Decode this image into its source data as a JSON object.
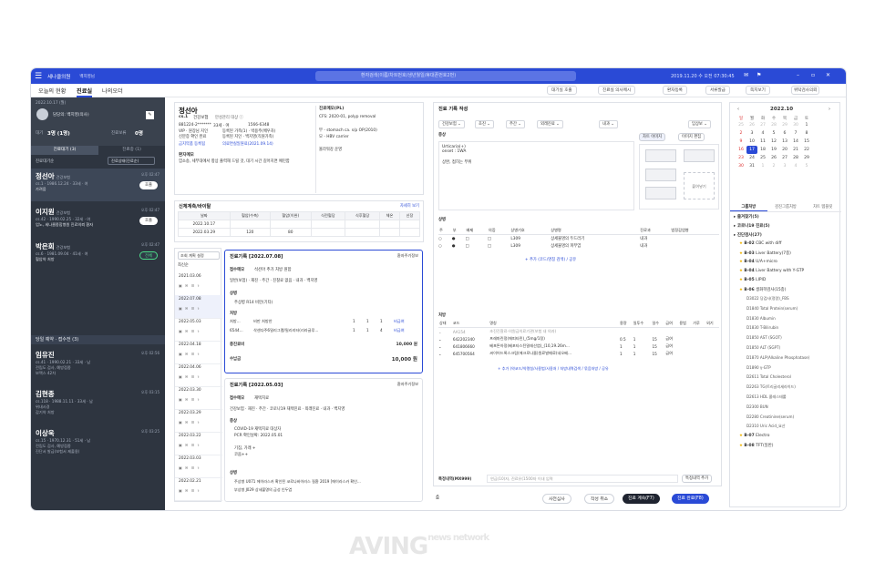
{
  "app": {
    "brand": "세나클의원",
    "user": "백지영님",
    "search_placeholder": "환자검색(이름/차트번호/생년월일/휴대폰번호2번)",
    "clock": "2019.11.20 수 오전 07:30:45"
  },
  "nav": {
    "tabs": [
      "오늘의 현황",
      "진료실",
      "나의오더"
    ],
    "buttons": [
      "대기실 호출",
      "진료실 의사메시",
      "환자등록",
      "서류발급",
      "쪽지보기",
      "위탁검사의뢰"
    ]
  },
  "left": {
    "date": "2022.10.17 (월)",
    "doctor": "담당의: 백지영(의사)",
    "counts": {
      "waiting_label": "대기",
      "waiting": "3명 (1명)",
      "done_label": "진료보류",
      "done": "0명"
    },
    "tabs": [
      "진료대기 (3)",
      "진료중 (1)"
    ],
    "filter": "진료대기순",
    "filter2": "진료상태(진료순)",
    "patients": [
      {
        "name": "정선아",
        "ins": "건강보험",
        "info": "cs.1 · 1986.12.24 · 33세 · 여",
        "note": "가려움",
        "time": "오후 02:47",
        "btn": "호출"
      },
      {
        "name": "이지원",
        "ins": "건강보험",
        "info": "cs.42 · 1990.02.25 · 32세 · 여",
        "note": "업노, 세나클종합병원 진료의뢰 환자",
        "time": "오후 02:47",
        "btn": "호출"
      },
      {
        "name": "박은희",
        "ins": "건강보험",
        "info": "cs.6 · 1981.09.04 · 41세 · 여",
        "note": "혈압약 처방",
        "time": "오후 02:47",
        "btn": "전체"
      }
    ],
    "section2": "당일 예약 · 접수전 (3)",
    "reservations": [
      {
        "name": "임유진",
        "ins": "건강보험",
        "info": "cs.41 · 1990.02.21 · 33세 · 남",
        "note": "전립도 검사, 예방접종",
        "note2": "보맥스 42차",
        "time": "오후 02:56"
      },
      {
        "name": "김현종",
        "ins": "건강보험",
        "info": "cs.118 · 1988.11.11 · 33세 · 남",
        "note": "위내시경",
        "note2": "감기약 처방",
        "time": "오후 03:15"
      },
      {
        "name": "이상욱",
        "ins": "건강보험",
        "info": "cs.15 · 1970.12.31 · 51세 · 남",
        "note": "전립도 검사, 예방접종",
        "note2": "진단서 발급(보험서 제출용)",
        "time": "오후 03:25"
      }
    ]
  },
  "patient": {
    "name": "정선아",
    "chart": "cs.1",
    "ins": "건강보험",
    "tag": "만성관리 대상 ⓘ",
    "rrn": "881224-2*******",
    "age": "33세 · 여",
    "phone": "1566-6348",
    "vip": "VIP · 원장님 지인",
    "reg1": "등록된 가족(1) · 박용주(배우자)",
    "reg2": "신분증 확인 완료",
    "reg3": "등록된 지인 · 백지영(직원가족)",
    "links": [
      "금지약품 등록됨",
      "의료면실일원료(2021.09.14)"
    ],
    "memo_label": "환자메모",
    "memo": "염소송, 세부대에서 항상 출력해 드릴 것, 대기 시간 길어지면 예민함",
    "history_label": "진료메모(PL)",
    "history": [
      "CFS: 2020-01, polyp removal",
      "부 - stomach ca. s/p OP(2010)",
      "모 - HBV carrier",
      "올라워강 운영"
    ]
  },
  "vitals": {
    "title": "신체계측/바이탈",
    "more": "자세히 보기",
    "headers": [
      "날짜",
      "혈압(수축)",
      "혈압(이완)",
      "식전혈당",
      "식후혈당",
      "체온",
      "신장"
    ],
    "rows": [
      [
        "2022.10.17",
        "",
        "",
        "",
        "",
        "",
        ""
      ],
      [
        "2022.03.29",
        "120",
        "80",
        "",
        "",
        "",
        ""
      ]
    ]
  },
  "history_list": {
    "filter": "조회 계획 설정",
    "sort": "최신순",
    "dates": [
      "2021.03.06",
      "2022.07.08",
      "2022.05.03",
      "2022.04.18",
      "2022.04.06",
      "2022.03.30",
      "2022.03.29",
      "2022.03.22",
      "2022.03.03",
      "2022.02.21"
    ]
  },
  "records": [
    {
      "title": "진료기록 [2022.07.08]",
      "copy": "환자주기정보",
      "memo_label": "접수메모",
      "memo": "석션아 추가 처방 원함",
      "types": "일반(보험) · 재진 · 주간 · 진찰료 없음 · 내과 · 백지영",
      "cond": "상병",
      "cond_rows": [
        "주상병 R14 비만(기타)"
      ],
      "rx": "처방",
      "rx_rows": [
        [
          "처방...",
          "비만 처방안",
          "1",
          "1",
          "1",
          "비급여"
        ],
        [
          "6544...",
          "삭센다주6밀리그램/밀리리터(리라글루...",
          "1",
          "1",
          "4",
          "비급여"
        ]
      ],
      "total_label": "총진료비",
      "total": "10,000 원",
      "recv_label": "수납금",
      "recv": "10,000 원"
    },
    {
      "title": "진료기록 [2022.05.03]",
      "copy": "환자주기정보",
      "memo_label": "접수메모",
      "memo": "재택치료",
      "types": "건강보험 · 재진 · 주간 · 코로나19 재택진료 · 외래진료 · 내과 · 백지영",
      "sym": "증상",
      "sym_rows": [
        "COVID-19 재택치료 대상자",
        "PCR 확인날짜: 2022.05.01",
        "기침, 가래 +",
        "코움++"
      ],
      "cond": "상병",
      "cond_rows": [
        "주상병 U071 에이라스카 확인된 코로나바이러스 질환 2019 [에이라스카 확인...",
        "부상병 J029 상세불명의 급성 인두염"
      ]
    }
  ],
  "write": {
    "title": "진료 기록 작성",
    "selects": [
      "건강보험",
      "초진",
      "주간",
      "외래진료",
      "내과",
      "임상보"
    ],
    "symptom_label": "증상",
    "symptom": [
      "Urticaria(+)",
      "onset : 1WA",
      "상완, 접히는 부위"
    ],
    "images": [
      "차트 이미지",
      "이미지 편집"
    ],
    "img_label": "붙여넣기",
    "cond_label": "상병",
    "cond_headers": [
      "주",
      "부",
      "배제",
      "의증",
      "상병기호",
      "상병명",
      "진료과",
      "법정감염병"
    ],
    "cond_rows": [
      [
        "L309",
        "상세불명의 두드러기",
        "내과"
      ],
      [
        "L309",
        "상세불명의 피부염",
        "내과"
      ]
    ],
    "cond_add": "+ 추가 (코드/명칭 검색) / 공유",
    "rx_label": "처방",
    "rx_headers": [
      "상태",
      "코드",
      "명칭",
      "용량",
      "일투수",
      "일수",
      "급여",
      "용법",
      "가루",
      "외기"
    ],
    "rx_rows": [
      [
        "AA154",
        "초진진찰료-의원급의료기관(보험 내 의과)",
        "",
        "",
        "",
        ""
      ],
      [
        "642202340",
        "프레마린정(에피타민)_(5mg/1정)",
        "0.5",
        "1",
        "15",
        "급여"
      ],
      [
        "641806660",
        "베포튼아정(베포타스틴말레산염)_(10,19.26m...",
        "1",
        "1",
        "15",
        "급여"
      ],
      [
        "645700564",
        "씨이어드록스크림(에크로나졸)원료발매료(네오베...",
        "1",
        "1",
        "15",
        "급여"
      ]
    ],
    "rx_add": "+ 추가 (약코드/약명칭/사용법/사용처 / 처방내역검색 / 묶음처방 / 공유",
    "special_label": "특정내역(MX999)",
    "special_placeholder": "연금(10)자, 진료유(1500자 이내 입력",
    "special_btn": "특정내역 추가"
  },
  "footer": {
    "left_btn": "처방전",
    "btns": [
      "사전심사",
      "작성 취소",
      "진료 계속(F7)",
      "진료 완료(F8)"
    ]
  },
  "right": {
    "month": "2022.10",
    "weekdays": [
      "일",
      "월",
      "화",
      "수",
      "목",
      "금",
      "토"
    ],
    "weeks": [
      [
        "25",
        "26",
        "27",
        "28",
        "29",
        "30",
        "1"
      ],
      [
        "2",
        "3",
        "4",
        "5",
        "6",
        "7",
        "8"
      ],
      [
        "9",
        "10",
        "11",
        "12",
        "13",
        "14",
        "15"
      ],
      [
        "16",
        "17",
        "18",
        "19",
        "20",
        "21",
        "22"
      ],
      [
        "23",
        "24",
        "25",
        "26",
        "27",
        "28",
        "29"
      ],
      [
        "30",
        "31",
        "1",
        "2",
        "3",
        "4",
        "5"
      ]
    ],
    "today": "17",
    "tabs": [
      "그룹처방",
      "검진그룹처방",
      "차트 템플릿"
    ],
    "groups": [
      "즐겨찾기(5)",
      "코로나19 진료(5)",
      "진단검사(27)"
    ],
    "items": [
      {
        "code": "B-02",
        "label": "CBC with diff"
      },
      {
        "code": "B-03",
        "label": "Liver Battery(7종)"
      },
      {
        "code": "B-04",
        "label": "U/A+micro"
      },
      {
        "code": "B-04",
        "label": "Liver Battery with Y-GTP"
      },
      {
        "code": "B-05",
        "label": "LIPID"
      },
      {
        "code": "B-06",
        "label": "생화학검사(15종)"
      }
    ],
    "subitems": [
      "D3022 당검사(정량)_FBS",
      "D1840 Total Protein(serum)",
      "D1830 Albumin",
      "D1830 T-Bilirubin",
      "D1850 AST (SGOT)",
      "D1850 ALT (SGPT)",
      "D1870 ALP(Alkaline Phosphatase)",
      "D1890 γ-GTP",
      "D2611 Total Cholesterol",
      "D2263 TG(트리글리세라이드)",
      "D2613 HDL 콜레스테롤",
      "D2300 BUN",
      "D2280 Creatinine(serum)",
      "D2310 Uric Acid_요산"
    ],
    "tail": [
      {
        "code": "B-07",
        "label": "Electro"
      },
      {
        "code": "B-08",
        "label": "TFT(일반)"
      }
    ]
  }
}
